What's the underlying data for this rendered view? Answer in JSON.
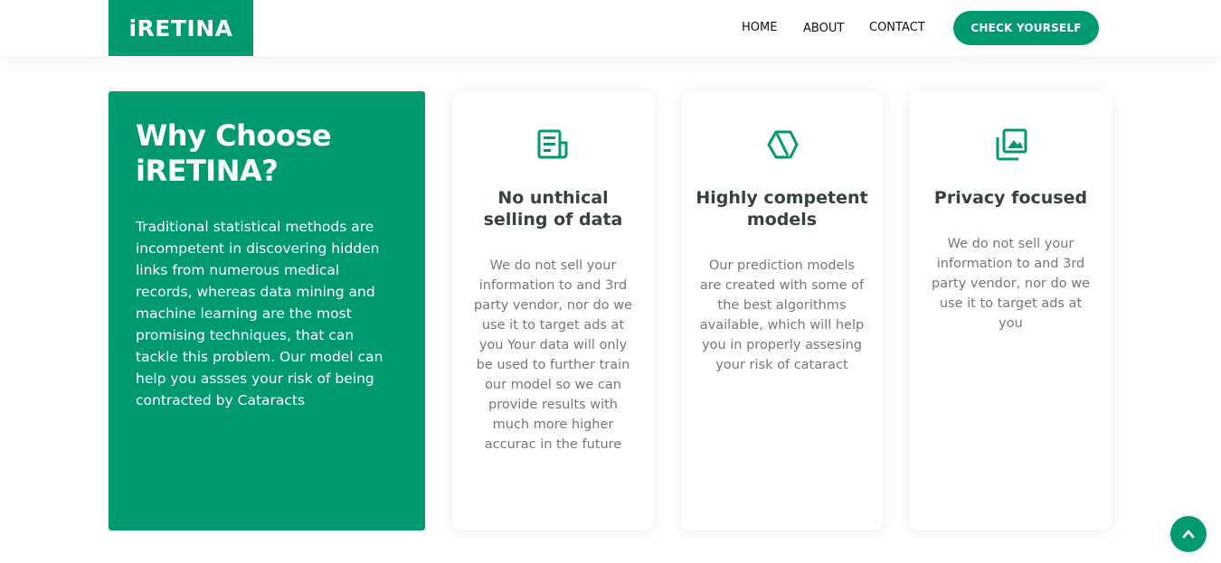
{
  "header": {
    "logo": "iRETINA",
    "nav": [
      "HOME",
      "ABOUT",
      "CONTACT"
    ],
    "cta": "CHECK YOURSELF"
  },
  "why": {
    "title": "Why Choose iRETINA?",
    "text": "Traditional statistical methods are incompetent in discovering hidden links from numerous medical records, whereas data mining and machine learning are the most promising techniques, that can tackle this problem. Our model can help you assses your risk of being contracted by Cataracts"
  },
  "cards": [
    {
      "icon": "receipt-icon",
      "title": "No unthical selling of data",
      "text": "We do not sell your information to and 3rd party vendor, nor do we use it to target ads at you Your data will only be used to further train our model so we can provide results with much more higher accurac in the future"
    },
    {
      "icon": "cube-icon",
      "title": "Highly competent models",
      "text": "Our prediction models are created with some of the best algorithms available, which will help you in properly assesing your risk of cataract"
    },
    {
      "icon": "images-icon",
      "title": "Privacy focused",
      "text": "We do not sell your information to and 3rd party vendor, nor do we use it to target ads at you"
    }
  ],
  "colors": {
    "accent": "#009970",
    "card_title": "#37423b",
    "card_text": "#777777"
  },
  "back_to_top_icon": "chevron-up-icon"
}
